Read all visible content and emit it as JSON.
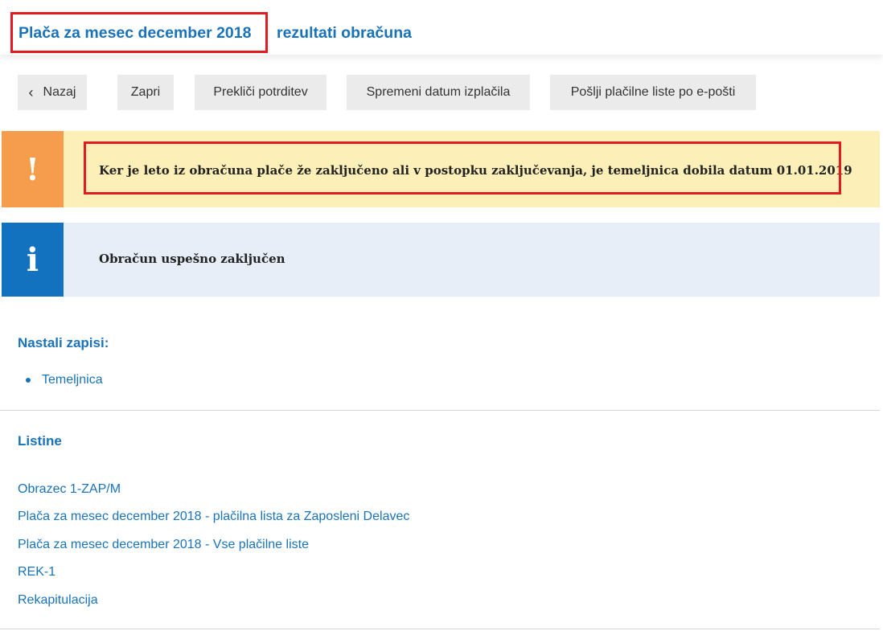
{
  "header": {
    "title": "Plača za mesec december 2018",
    "subtitle": "rezultati obračuna"
  },
  "toolbar": {
    "back_label": "Nazaj",
    "close_label": "Zapri",
    "cancel_confirm_label": "Prekliči potrditev",
    "change_date_label": "Spremeni datum izplačila",
    "send_email_label": "Pošlji plačilne liste po e-pošti"
  },
  "alerts": {
    "warning_icon": "!",
    "warning_text": "Ker je leto iz obračuna plače že zaključeno ali v postopku zaključevanja, je temeljnica dobila datum 01.01.2019",
    "info_icon": "i",
    "info_text": "Obračun uspešno zaključen"
  },
  "records": {
    "title": "Nastali zapisi:",
    "items": [
      "Temeljnica"
    ]
  },
  "documents": {
    "title": "Listine",
    "links": [
      "Obrazec 1-ZAP/M",
      "Plača za mesec december 2018 - plačilna lista za Zaposleni Delavec",
      "Plača za mesec december 2018 - Vse plačilne liste",
      "REK-1",
      "Rekapitulacija"
    ]
  },
  "colors": {
    "accent": "#1a73b8",
    "warning_bg": "#fcefb7",
    "warning_icon_bg": "#f59d4c",
    "info_bg": "#e8eef8",
    "info_icon_bg": "#1272bf",
    "highlight_border": "#e11b22"
  }
}
